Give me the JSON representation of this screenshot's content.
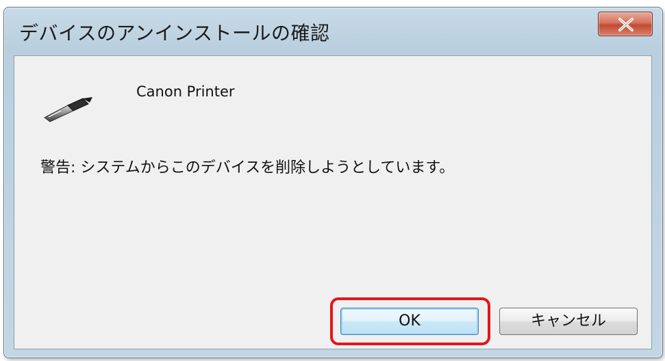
{
  "window": {
    "title": "デバイスのアンインストールの確認",
    "close_icon": "close-icon"
  },
  "device": {
    "icon": "usb-connector-icon",
    "name": "Canon Printer"
  },
  "message": {
    "warning": "警告: システムからこのデバイスを削除しようとしています。"
  },
  "buttons": {
    "ok_label": "OK",
    "cancel_label": "キャンセル"
  },
  "colors": {
    "highlight": "#e3151c",
    "close_button": "#c24a31"
  }
}
